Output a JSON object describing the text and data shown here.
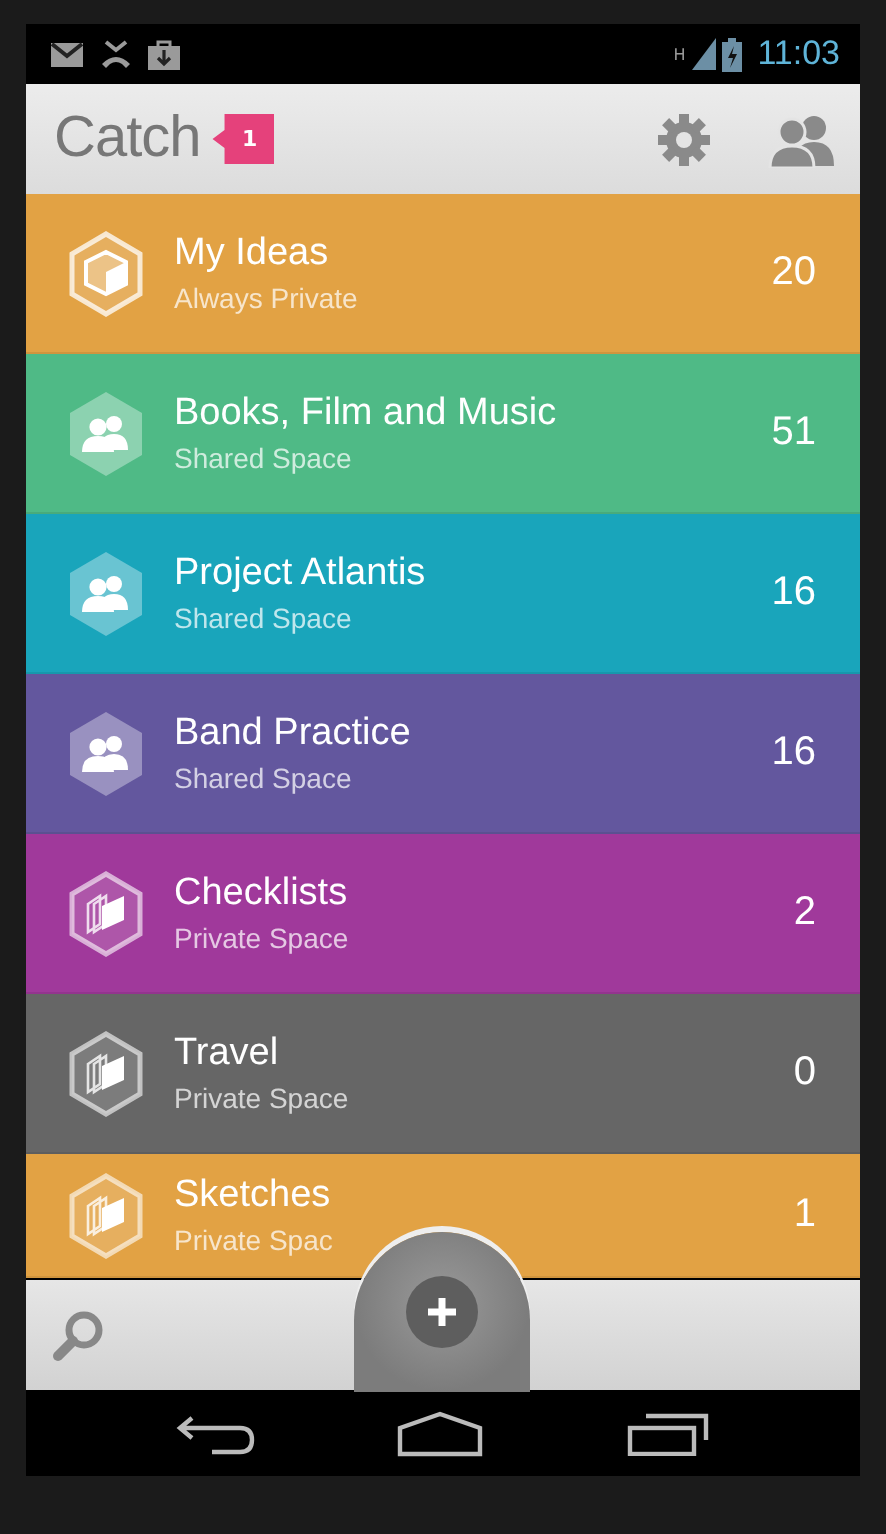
{
  "status_bar": {
    "network": "H",
    "time": "11:03"
  },
  "app_bar": {
    "title": "Catch",
    "badge": "1"
  },
  "spaces": [
    {
      "name": "My Ideas",
      "subtitle": "Always Private",
      "count": "20",
      "kind": "private",
      "color": "#e2a244"
    },
    {
      "name": "Books, Film and Music",
      "subtitle": "Shared Space",
      "count": "51",
      "kind": "shared",
      "color": "#4fba86"
    },
    {
      "name": "Project Atlantis",
      "subtitle": "Shared Space",
      "count": "16",
      "kind": "shared",
      "color": "#19a5bb"
    },
    {
      "name": "Band Practice",
      "subtitle": "Shared Space",
      "count": "16",
      "kind": "shared",
      "color": "#63579e"
    },
    {
      "name": "Checklists",
      "subtitle": "Private Space",
      "count": "2",
      "kind": "space",
      "color": "#a0399b"
    },
    {
      "name": "Travel",
      "subtitle": "Private Space",
      "count": "0",
      "kind": "space",
      "color": "#666666"
    },
    {
      "name": "Sketches",
      "subtitle": "Private Spac",
      "count": "1",
      "kind": "space",
      "color": "#e2a244"
    }
  ]
}
